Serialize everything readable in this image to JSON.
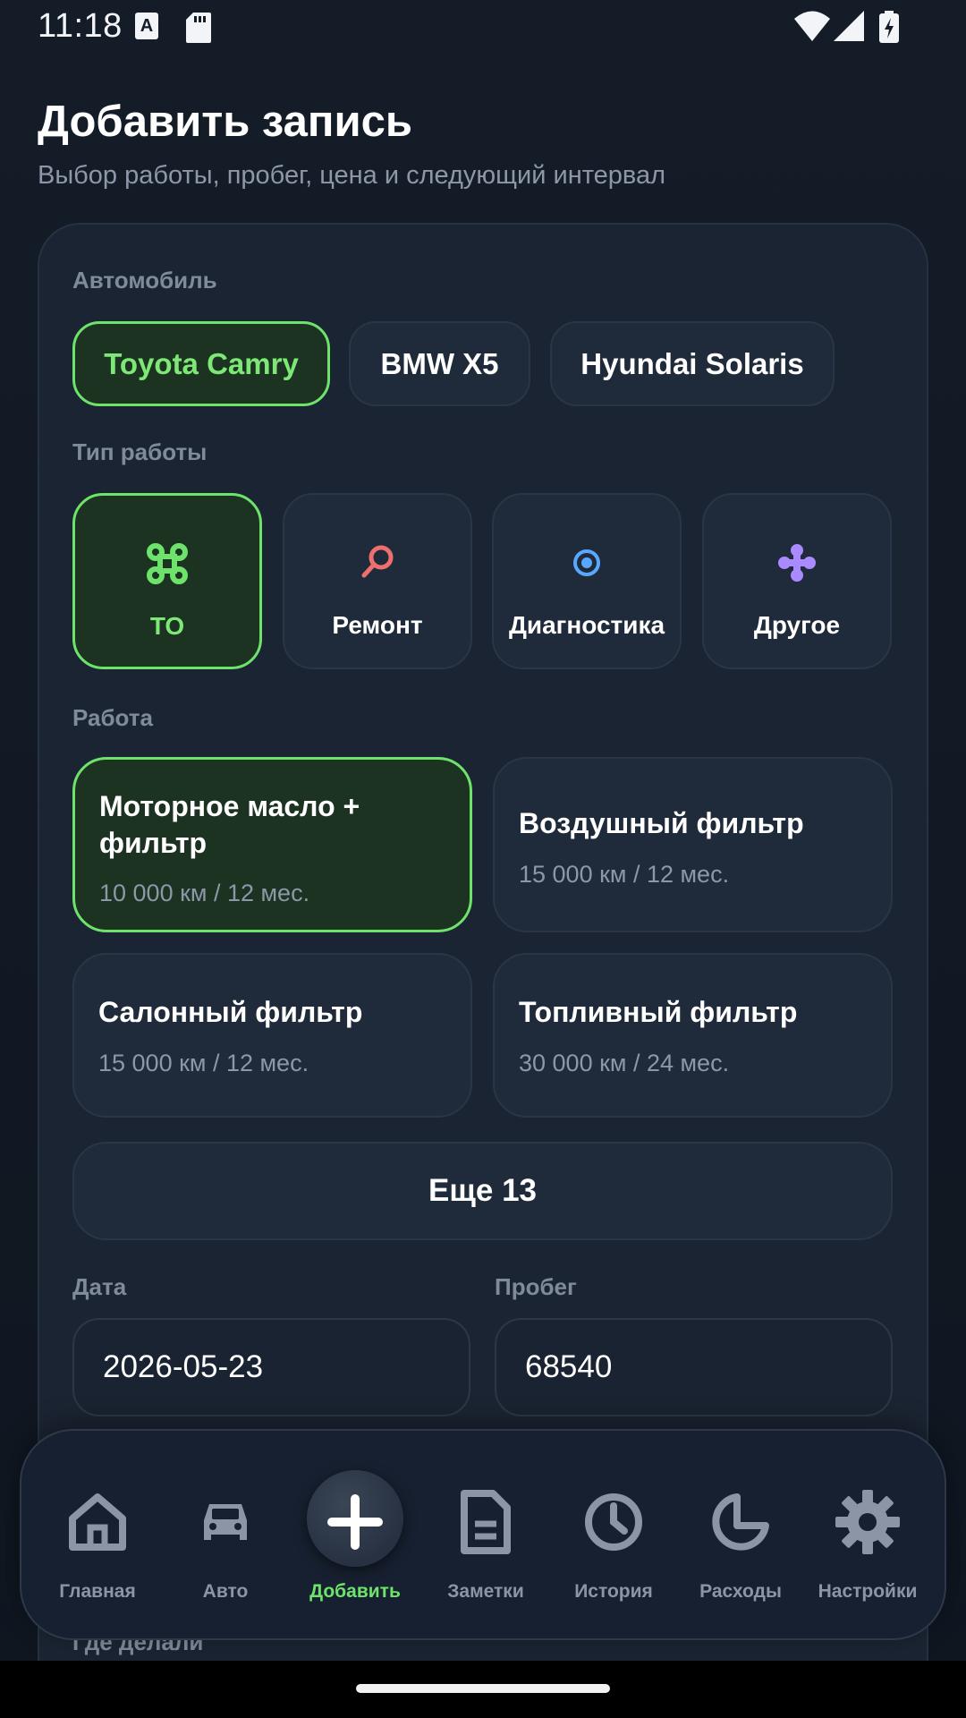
{
  "status_bar": {
    "time": "11:18",
    "icons": [
      "keyboard-a-icon",
      "sd-card-icon",
      "wifi-icon",
      "signal-icon",
      "battery-charging-icon"
    ]
  },
  "header": {
    "title": "Добавить запись",
    "subtitle": "Выбор работы, пробег, цена и следующий интервал"
  },
  "car_section": {
    "label": "Автомобиль",
    "cars": [
      {
        "label": "Toyota Camry",
        "selected": true
      },
      {
        "label": "BMW X5",
        "selected": false
      },
      {
        "label": "Hyundai Solaris",
        "selected": false
      }
    ]
  },
  "work_type_section": {
    "label": "Тип работы",
    "types": [
      {
        "label": "ТО",
        "icon": "command-icon",
        "icon_color": "#6ee36b",
        "selected": true
      },
      {
        "label": "Ремонт",
        "icon": "magnifier-icon",
        "icon_color": "#ef6f6f",
        "selected": false
      },
      {
        "label": "Диагностика",
        "icon": "target-icon",
        "icon_color": "#5aa7ff",
        "selected": false
      },
      {
        "label": "Другое",
        "icon": "sparkle-icon",
        "icon_color": "#a98bff",
        "selected": false
      }
    ]
  },
  "work_section": {
    "label": "Работа",
    "items": [
      {
        "title": "Моторное масло + фильтр",
        "interval": "10 000 км / 12 мес.",
        "selected": true
      },
      {
        "title": "Воздушный фильтр",
        "interval": "15 000 км / 12 мес.",
        "selected": false
      },
      {
        "title": "Салонный фильтр",
        "interval": "15 000 км / 12 мес.",
        "selected": false
      },
      {
        "title": "Топливный фильтр",
        "interval": "30 000 км / 24 мес.",
        "selected": false
      }
    ],
    "more_label": "Еще 13"
  },
  "fields": {
    "date_label": "Дата",
    "date_value": "2026-05-23",
    "mileage_label": "Пробег",
    "mileage_value": "68540",
    "where_label": "Где делали"
  },
  "bottom_nav": {
    "items": [
      {
        "label": "Главная",
        "icon": "home-icon",
        "active": false
      },
      {
        "label": "Авто",
        "icon": "car-icon",
        "active": false
      },
      {
        "label": "Добавить",
        "icon": "plus-icon",
        "active": true
      },
      {
        "label": "Заметки",
        "icon": "document-icon",
        "active": false
      },
      {
        "label": "История",
        "icon": "clock-icon",
        "active": false
      },
      {
        "label": "Расходы",
        "icon": "pie-chart-icon",
        "active": false
      },
      {
        "label": "Настройки",
        "icon": "gear-icon",
        "active": false
      }
    ]
  },
  "colors": {
    "accent": "#6ee36b",
    "background": "#141c28",
    "card": "#1b2432",
    "muted_text": "#8d97a7"
  }
}
